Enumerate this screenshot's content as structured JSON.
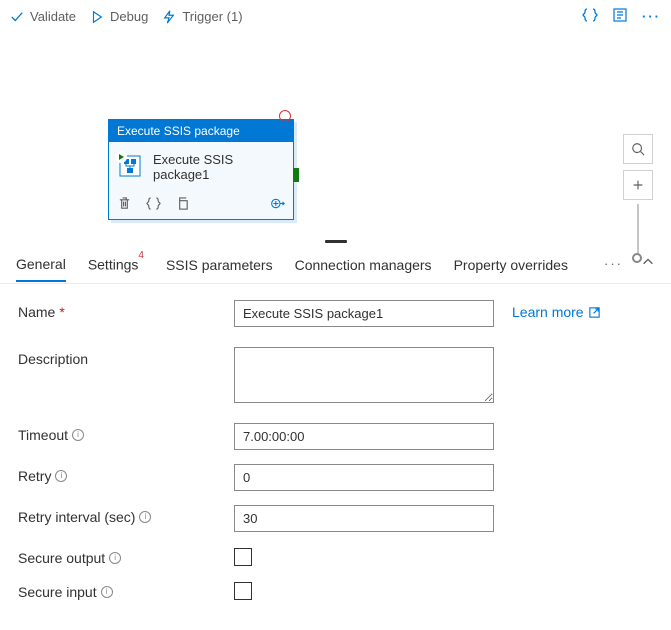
{
  "toolbar": {
    "validate": "Validate",
    "debug": "Debug",
    "trigger": "Trigger (1)"
  },
  "activity": {
    "type_label": "Execute SSIS package",
    "name": "Execute SSIS package1"
  },
  "tabs": {
    "general": "General",
    "settings": "Settings",
    "settings_badge": "4",
    "ssis_parameters": "SSIS parameters",
    "connection_managers": "Connection managers",
    "property_overrides": "Property overrides"
  },
  "form": {
    "name_label": "Name",
    "name_value": "Execute SSIS package1",
    "learn_more": "Learn more",
    "description_label": "Description",
    "description_value": "",
    "timeout_label": "Timeout",
    "timeout_value": "7.00:00:00",
    "retry_label": "Retry",
    "retry_value": "0",
    "retry_interval_label": "Retry interval (sec)",
    "retry_interval_value": "30",
    "secure_output_label": "Secure output",
    "secure_input_label": "Secure input"
  }
}
